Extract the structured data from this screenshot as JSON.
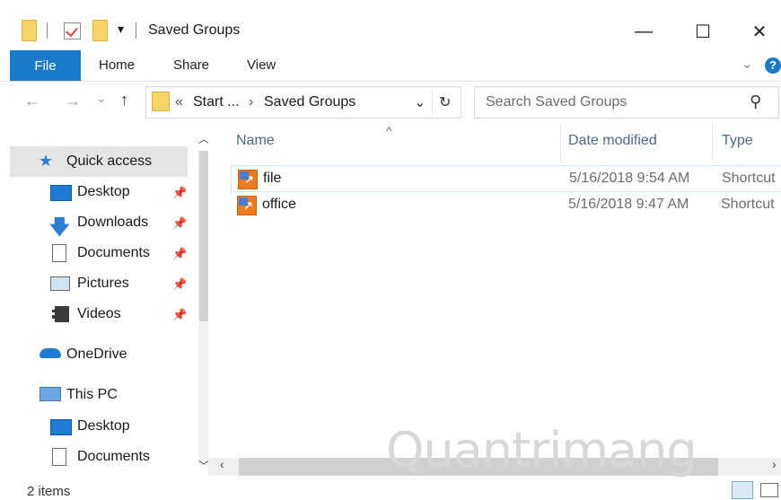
{
  "title_bar": {
    "title": "Saved Groups",
    "qa_dropdown": "▾",
    "minimize": "—",
    "maximize": "☐",
    "close": "✕"
  },
  "ribbon": {
    "tabs": [
      "File",
      "Home",
      "Share",
      "View"
    ],
    "expand_chevron": "⌄",
    "help": "?"
  },
  "address": {
    "back": "←",
    "forward": "→",
    "recent": "⌄",
    "up": "↑",
    "breadcrumb_prefix": "«",
    "crumb_1": "Start ...",
    "crumb_sep": "›",
    "crumb_2": "Saved Groups",
    "dropdown": "⌄",
    "refresh": "↻"
  },
  "search": {
    "placeholder": "Search Saved Groups",
    "icon": "⚲"
  },
  "nav": {
    "quick_access": "Quick access",
    "qa_items": [
      {
        "label": "Desktop",
        "icon": "desktop-icon"
      },
      {
        "label": "Downloads",
        "icon": "downloads-icon"
      },
      {
        "label": "Documents",
        "icon": "documents-icon"
      },
      {
        "label": "Pictures",
        "icon": "pictures-icon"
      },
      {
        "label": "Videos",
        "icon": "videos-icon"
      }
    ],
    "onedrive": "OneDrive",
    "this_pc": "This PC",
    "pc_items": [
      {
        "label": "Desktop",
        "icon": "desktop-icon"
      },
      {
        "label": "Documents",
        "icon": "documents-icon"
      }
    ],
    "pin_glyph": "📌"
  },
  "columns": {
    "name": "Name",
    "date": "Date modified",
    "type": "Type",
    "sort_glyph": "^"
  },
  "files": [
    {
      "name": "file",
      "date": "5/16/2018 9:54 AM",
      "type": "Shortcut"
    },
    {
      "name": "office",
      "date": "5/16/2018 9:47 AM",
      "type": "Shortcut"
    }
  ],
  "status": {
    "count": "2 items"
  },
  "watermark": "Quantrimang",
  "colors": {
    "accent": "#1979ca",
    "selection_border": "#cce8ff",
    "header_text": "#4d6a8a"
  }
}
